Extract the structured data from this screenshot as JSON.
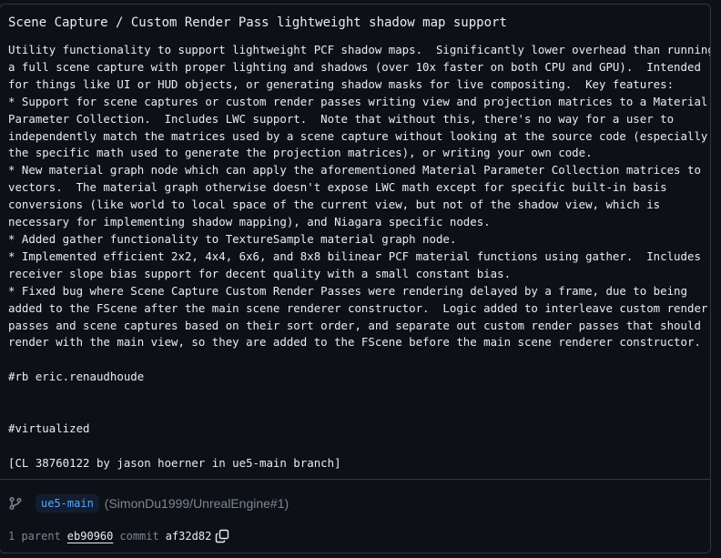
{
  "commit": {
    "title": "Scene Capture / Custom Render Pass lightweight shadow map support",
    "description": "Utility functionality to support lightweight PCF shadow maps.  Significantly lower overhead than running\na full scene capture with proper lighting and shadows (over 10x faster on both CPU and GPU).  Intended\nfor things like UI or HUD objects, or generating shadow masks for live compositing.  Key features:\n* Support for scene captures or custom render passes writing view and projection matrices to a Material\nParameter Collection.  Includes LWC support.  Note that without this, there's no way for a user to\nindependently match the matrices used by a scene capture without looking at the source code (especially\nthe specific math used to generate the projection matrices), or writing your own code.\n* New material graph node which can apply the aforementioned Material Parameter Collection matrices to\nvectors.  The material graph otherwise doesn't expose LWC math except for specific built-in basis\nconversions (like world to local space of the current view, but not of the shadow view, which is\nnecessary for implementing shadow mapping), and Niagara specific nodes.\n* Added gather functionality to TextureSample material graph node.\n* Implemented efficient 2x2, 4x4, 6x6, and 8x8 bilinear PCF material functions using gather.  Includes\nreceiver slope bias support for decent quality with a small constant bias.\n* Fixed bug where Scene Capture Custom Render Passes were rendering delayed by a frame, due to being\nadded to the FScene after the main scene renderer constructor.  Logic added to interleave custom render\npasses and scene captures based on their sort order, and separate out custom render passes that should\nrender with the main view, so they are added to the FScene before the main scene renderer constructor.\n\n#rb eric.renaudhoude\n\n\n#virtualized\n\n[CL 38760122 by jason hoerner in ue5-main branch]"
  },
  "branch": {
    "icon": "git-branch-icon",
    "name": "ue5-main",
    "repo_ref": "(SimonDu1999/UnrealEngine#1)"
  },
  "parents": {
    "label": "1 parent",
    "parent_sha": "eb90960",
    "commit_label": "commit",
    "commit_sha": "af32d82",
    "copy_icon": "copy-icon"
  },
  "colors": {
    "background": "#0d1117",
    "border": "#30363d",
    "text": "#e6edf3",
    "muted": "#7d8590",
    "accent": "#58a6ff"
  }
}
